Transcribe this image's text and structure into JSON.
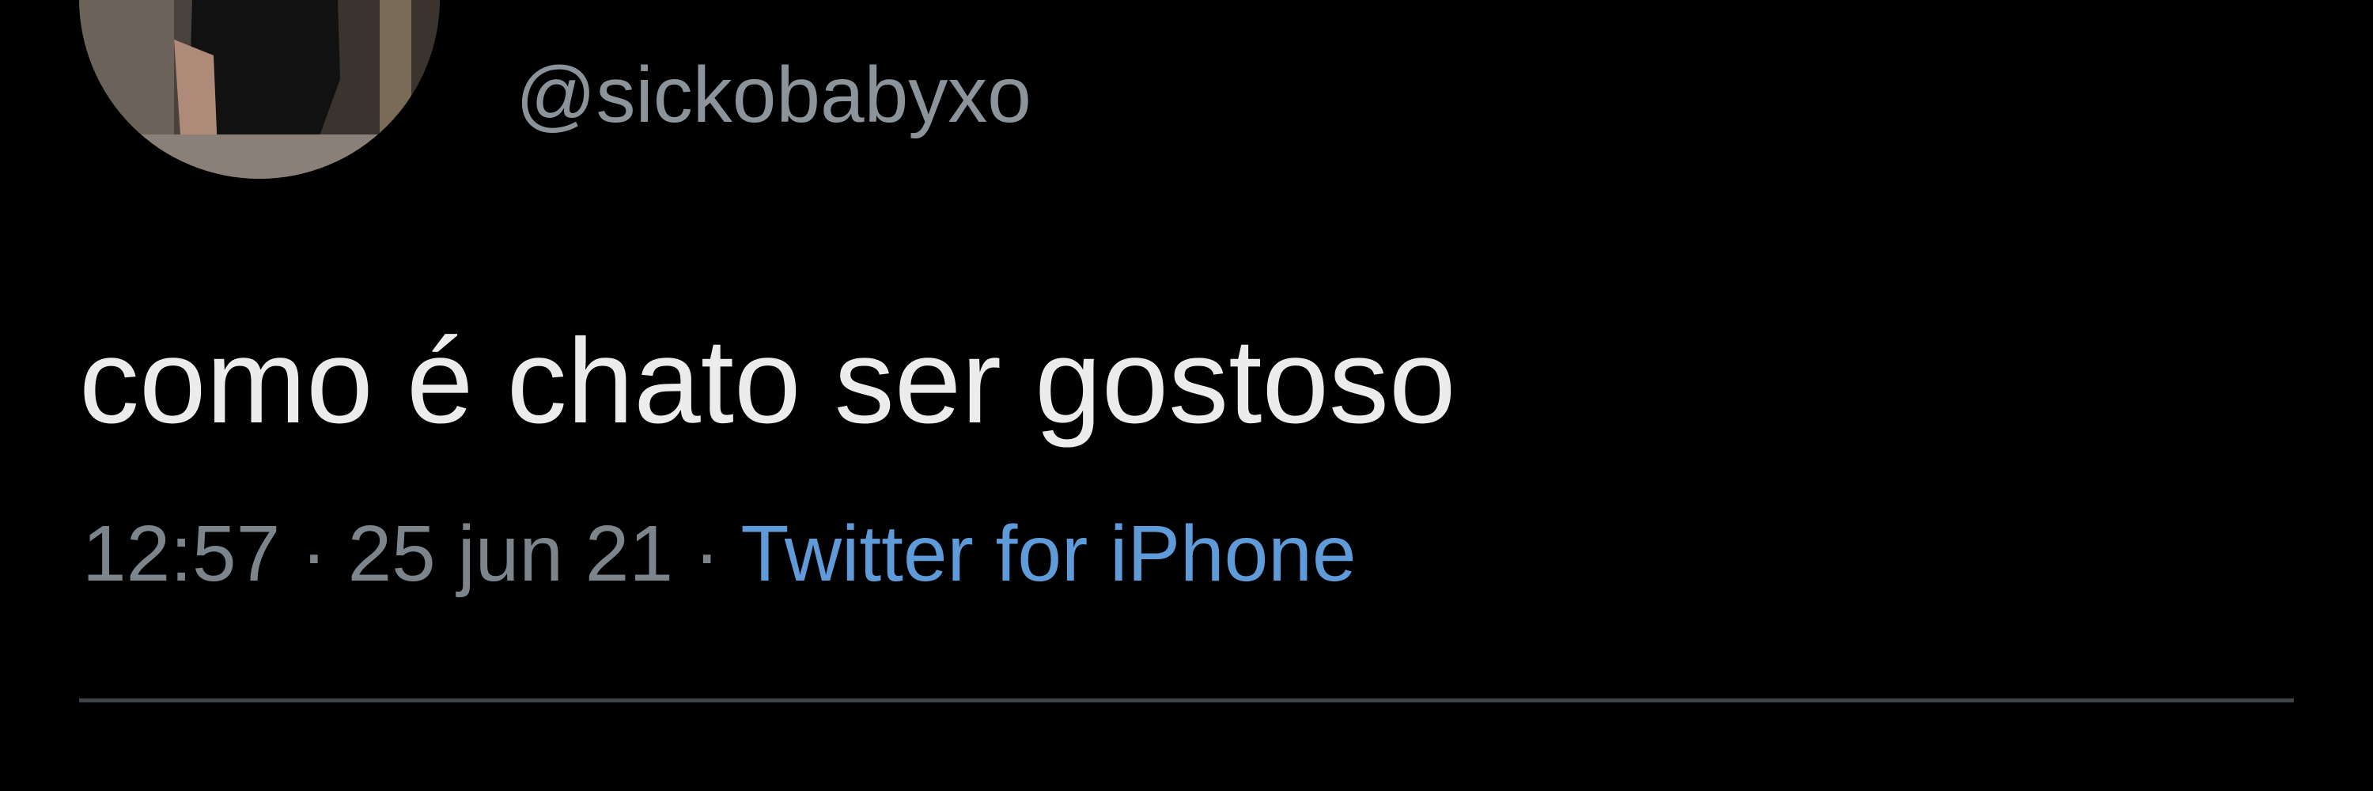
{
  "tweet": {
    "handle": "@sickobabyxo",
    "text": "como é chato ser gostoso",
    "time": "12:57",
    "date": "25 jun 21",
    "separator": "·",
    "source": "Twitter for iPhone"
  },
  "colors": {
    "background": "#000000",
    "text": "#ececec",
    "muted": "#7c848c",
    "link": "#5f9bd9",
    "divider": "#3f4448"
  }
}
